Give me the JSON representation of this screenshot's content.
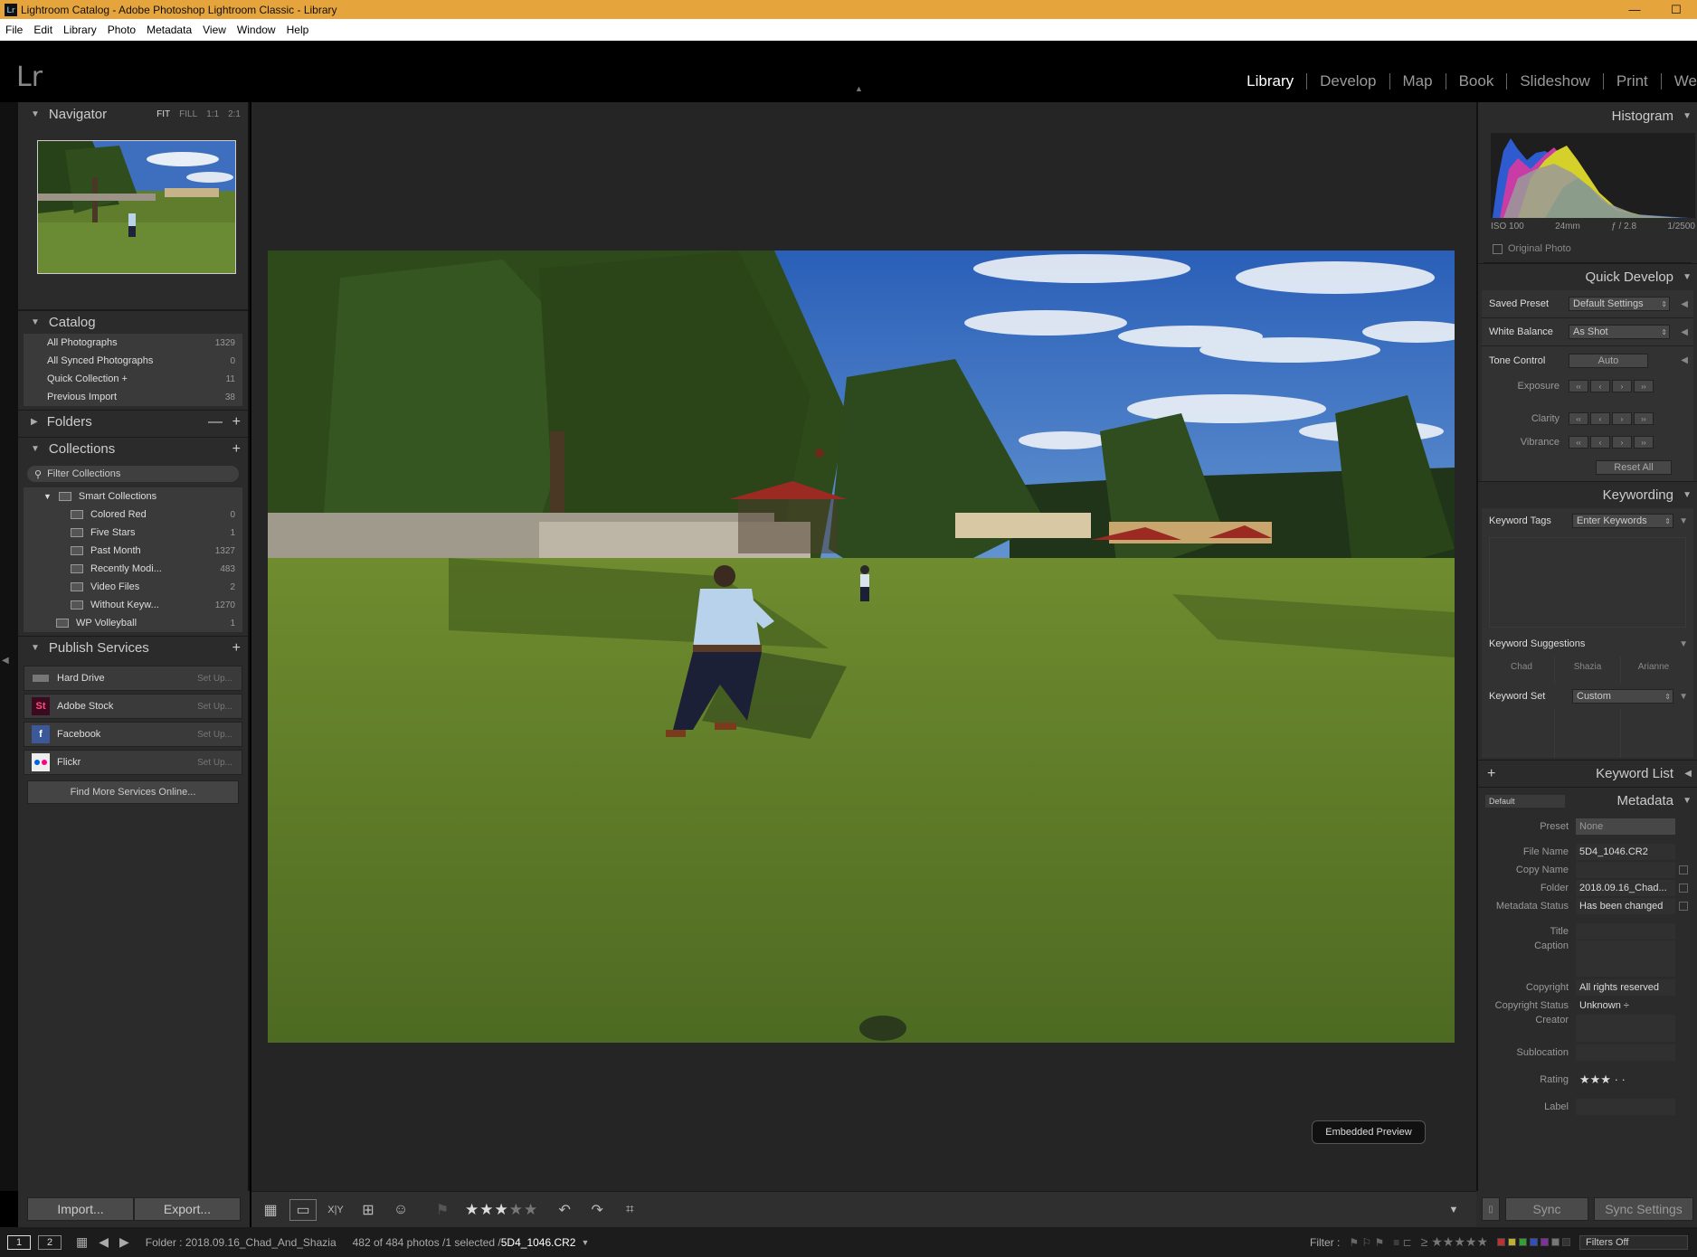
{
  "window": {
    "title": "Lightroom Catalog - Adobe Photoshop Lightroom Classic - Library",
    "app_icon": "Lr",
    "minimize": "—",
    "maximize": "☐"
  },
  "menu": [
    "File",
    "Edit",
    "Library",
    "Photo",
    "Metadata",
    "View",
    "Window",
    "Help"
  ],
  "logo": "Lr",
  "modules": [
    "Library",
    "Develop",
    "Map",
    "Book",
    "Slideshow",
    "Print",
    "We"
  ],
  "navigator": {
    "title": "Navigator",
    "options": [
      "FIT",
      "FILL",
      "1:1",
      "2:1"
    ]
  },
  "catalog": {
    "title": "Catalog",
    "items": [
      {
        "label": "All Photographs",
        "count": "1329"
      },
      {
        "label": "All Synced Photographs",
        "count": "0"
      },
      {
        "label": "Quick Collection +",
        "count": "11"
      },
      {
        "label": "Previous Import",
        "count": "38"
      }
    ]
  },
  "folders": {
    "title": "Folders",
    "minus": "—",
    "plus": "+"
  },
  "collections": {
    "title": "Collections",
    "filter_placeholder": "Filter Collections",
    "smart_label": "Smart Collections",
    "items": [
      {
        "label": "Colored Red",
        "count": "0"
      },
      {
        "label": "Five Stars",
        "count": "1"
      },
      {
        "label": "Past Month",
        "count": "1327"
      },
      {
        "label": "Recently Modi...",
        "count": "483"
      },
      {
        "label": "Video Files",
        "count": "2"
      },
      {
        "label": "Without Keyw...",
        "count": "1270"
      }
    ],
    "wp": {
      "label": "WP Volleyball",
      "count": "1"
    }
  },
  "publish": {
    "title": "Publish Services",
    "services": [
      {
        "label": "Hard Drive",
        "setup": "Set Up..."
      },
      {
        "label": "Adobe Stock",
        "setup": "Set Up...",
        "icon": "St"
      },
      {
        "label": "Facebook",
        "setup": "Set Up...",
        "icon": "f"
      },
      {
        "label": "Flickr",
        "setup": "Set Up..."
      }
    ],
    "find_more": "Find More Services Online..."
  },
  "left_buttons": {
    "import": "Import...",
    "export": "Export..."
  },
  "embedded_preview": "Embedded Preview",
  "histogram": {
    "title": "Histogram",
    "iso": "ISO 100",
    "focal": "24mm",
    "aperture": "ƒ / 2.8",
    "shutter": "1/2500",
    "original": "Original Photo"
  },
  "quick_develop": {
    "title": "Quick Develop",
    "saved_preset_label": "Saved Preset",
    "saved_preset": "Default Settings",
    "wb_label": "White Balance",
    "wb": "As Shot",
    "tone_label": "Tone Control",
    "auto": "Auto",
    "exposure": "Exposure",
    "clarity": "Clarity",
    "vibrance": "Vibrance",
    "reset": "Reset All"
  },
  "keywording": {
    "title": "Keywording",
    "tags_label": "Keyword Tags",
    "tags_value": "Enter Keywords",
    "suggestions_label": "Keyword Suggestions",
    "suggestions": [
      "Chad",
      "Shazia",
      "Arianne"
    ],
    "set_label": "Keyword Set",
    "set_value": "Custom"
  },
  "keyword_list": {
    "title": "Keyword List",
    "plus": "+"
  },
  "metadata": {
    "title": "Metadata",
    "default": "Default",
    "fields": [
      {
        "label": "Preset",
        "value": "None"
      },
      {
        "label": "File Name",
        "value": "5D4_1046.CR2"
      },
      {
        "label": "Copy Name",
        "value": ""
      },
      {
        "label": "Folder",
        "value": "2018.09.16_Chad..."
      },
      {
        "label": "Metadata Status",
        "value": "Has been changed"
      },
      {
        "label": "Title",
        "value": ""
      },
      {
        "label": "Caption",
        "value": ""
      },
      {
        "label": "Copyright",
        "value": "All rights reserved"
      },
      {
        "label": "Copyright Status",
        "value": "Unknown ÷"
      },
      {
        "label": "Creator",
        "value": ""
      },
      {
        "label": "Sublocation",
        "value": ""
      },
      {
        "label": "Rating",
        "value": "★★★ · ·"
      },
      {
        "label": "Label",
        "value": ""
      }
    ]
  },
  "right_buttons": {
    "sync": "Sync",
    "sync_settings": "Sync Settings"
  },
  "rating": {
    "stars": 3,
    "max": 5
  },
  "filmstrip": {
    "screen1": "1",
    "screen2": "2",
    "folder": "Folder : 2018.09.16_Chad_And_Shazia",
    "count": "482 of 484 photos /1 selected /",
    "file": "5D4_1046.CR2",
    "filter_label": "Filter :",
    "filter_value": "Filters Off"
  }
}
